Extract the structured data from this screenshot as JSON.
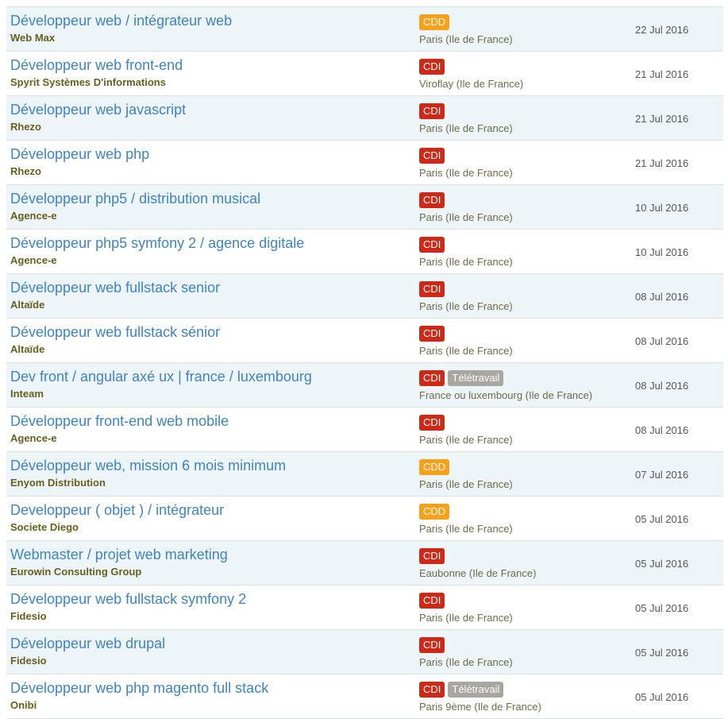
{
  "colors": {
    "title": "#3d84c6",
    "company": "#66601e",
    "location": "#6f6b47",
    "badge_cdd": "#f7a11a",
    "badge_cdi": "#cc2a16",
    "badge_teletravail": "#a7a7a0",
    "row_alt_bg": "#eef5f9",
    "divider": "#d9e2ea"
  },
  "jobs": [
    {
      "title": "Développeur web / intégrateur web",
      "company": "Web Max",
      "contract": "CDD",
      "remote": "",
      "location": "Paris (Ile de France)",
      "date": "22 Jul 2016"
    },
    {
      "title": "Développeur web front-end",
      "company": "Spyrit Systèmes D'informations",
      "contract": "CDI",
      "remote": "",
      "location": "Viroflay (Ile de France)",
      "date": "21 Jul 2016"
    },
    {
      "title": "Développeur web javascript",
      "company": "Rhezo",
      "contract": "CDI",
      "remote": "",
      "location": "Paris (Ile de France)",
      "date": "21 Jul 2016"
    },
    {
      "title": "Développeur web php",
      "company": "Rhezo",
      "contract": "CDI",
      "remote": "",
      "location": "Paris (Ile de France)",
      "date": "21 Jul 2016"
    },
    {
      "title": "Développeur php5 / distribution musical",
      "company": "Agence-e",
      "contract": "CDI",
      "remote": "",
      "location": "Paris (Ile de France)",
      "date": "10 Jul 2016"
    },
    {
      "title": "Développeur php5 symfony 2 / agence digitale",
      "company": "Agence-e",
      "contract": "CDI",
      "remote": "",
      "location": "Paris (Ile de France)",
      "date": "10 Jul 2016"
    },
    {
      "title": "Développeur web fullstack senior",
      "company": "Altaïde",
      "contract": "CDI",
      "remote": "",
      "location": "Paris (Ile de France)",
      "date": "08 Jul 2016"
    },
    {
      "title": "Développeur web fullstack sénior",
      "company": "Altaïde",
      "contract": "CDI",
      "remote": "",
      "location": "Paris (Ile de France)",
      "date": "08 Jul 2016"
    },
    {
      "title": "Dev front / angular axé ux | france / luxembourg",
      "company": "Inteam",
      "contract": "CDI",
      "remote": "Télétravail",
      "location": "France ou luxembourg (Ile de France)",
      "date": "08 Jul 2016"
    },
    {
      "title": "Développeur front-end web mobile",
      "company": "Agence-e",
      "contract": "CDI",
      "remote": "",
      "location": "Paris (Ile de France)",
      "date": "08 Jul 2016"
    },
    {
      "title": "Développeur web, mission 6 mois minimum",
      "company": "Enyom Distribution",
      "contract": "CDD",
      "remote": "",
      "location": "Paris (Ile de France)",
      "date": "07 Jul 2016"
    },
    {
      "title": "Developpeur ( objet ) / intégrateur",
      "company": "Societe Diego",
      "contract": "CDD",
      "remote": "",
      "location": "Paris (Ile de France)",
      "date": "05 Jul 2016"
    },
    {
      "title": "Webmaster / projet web marketing",
      "company": "Eurowin Consulting Group",
      "contract": "CDI",
      "remote": "",
      "location": "Eaubonne (Ile de France)",
      "date": "05 Jul 2016"
    },
    {
      "title": "Développeur web fullstack symfony 2",
      "company": "Fidesio",
      "contract": "CDI",
      "remote": "",
      "location": "Paris (Ile de France)",
      "date": "05 Jul 2016"
    },
    {
      "title": "Développeur web drupal",
      "company": "Fidesio",
      "contract": "CDI",
      "remote": "",
      "location": "Paris (Ile de France)",
      "date": "05 Jul 2016"
    },
    {
      "title": "Développeur web php magento full stack",
      "company": "Onibi",
      "contract": "CDI",
      "remote": "Télétravail",
      "location": "Paris 9ème (Ile de France)",
      "date": "05 Jul 2016"
    }
  ]
}
